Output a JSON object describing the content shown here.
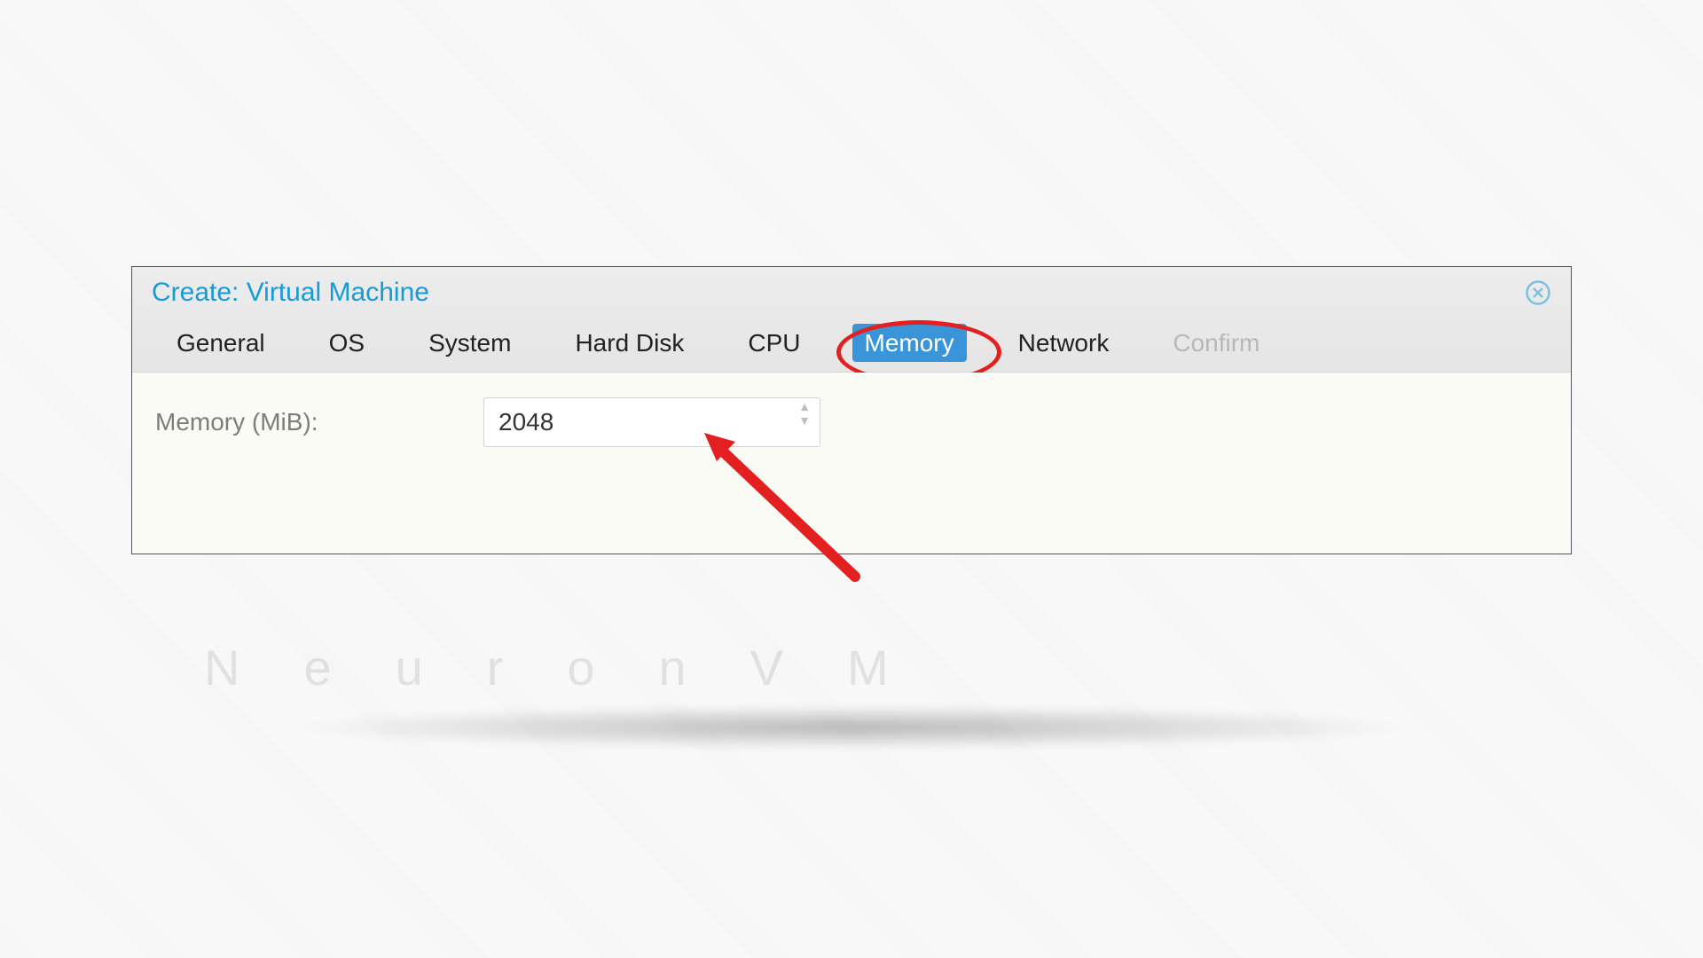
{
  "dialog": {
    "title": "Create: Virtual Machine"
  },
  "tabs": {
    "general": "General",
    "os": "OS",
    "system": "System",
    "harddisk": "Hard Disk",
    "cpu": "CPU",
    "memory": "Memory",
    "network": "Network",
    "confirm": "Confirm"
  },
  "body": {
    "memory_label": "Memory (MiB):",
    "memory_value": "2048"
  },
  "watermark": "NeuronVM"
}
